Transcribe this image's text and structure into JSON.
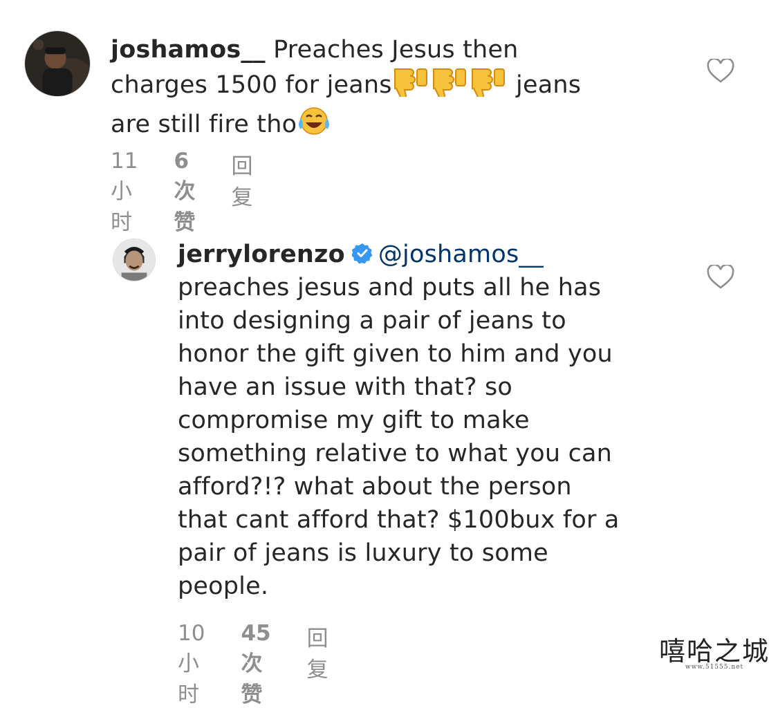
{
  "comments": [
    {
      "username": "joshamos__",
      "text_part1": "Preaches Jesus then\ncharges 1500 for jeans",
      "emoji_part1": "thumbs-down-emoji x3",
      "text_part2": " jeans\nare still fire tho",
      "emoji_part2": "tears-of-joy-emoji",
      "time": "11小时",
      "likes": "6次赞",
      "reply": "回复"
    },
    {
      "username": "jerrylorenzo",
      "verified": true,
      "mention": "@joshamos__",
      "text": "preaches jesus and puts all he has\ninto designing a pair of jeans to\nhonor the gift given to him and you\nhave an issue with that?  so\ncompromise my gift to make\nsomething relative to what you can\nafford?!? what about the person\nthat cant afford that? $100bux for a\npair of jeans is luxury to some\npeople.",
      "time": "10小时",
      "likes": "45次赞",
      "reply": "回复"
    }
  ],
  "watermark": {
    "text": "嘻哈之城",
    "sub": "www.51555.net"
  },
  "colors": {
    "text": "#262626",
    "meta": "#8e8e8e",
    "mention": "#003569",
    "verified": "#3897f0"
  }
}
